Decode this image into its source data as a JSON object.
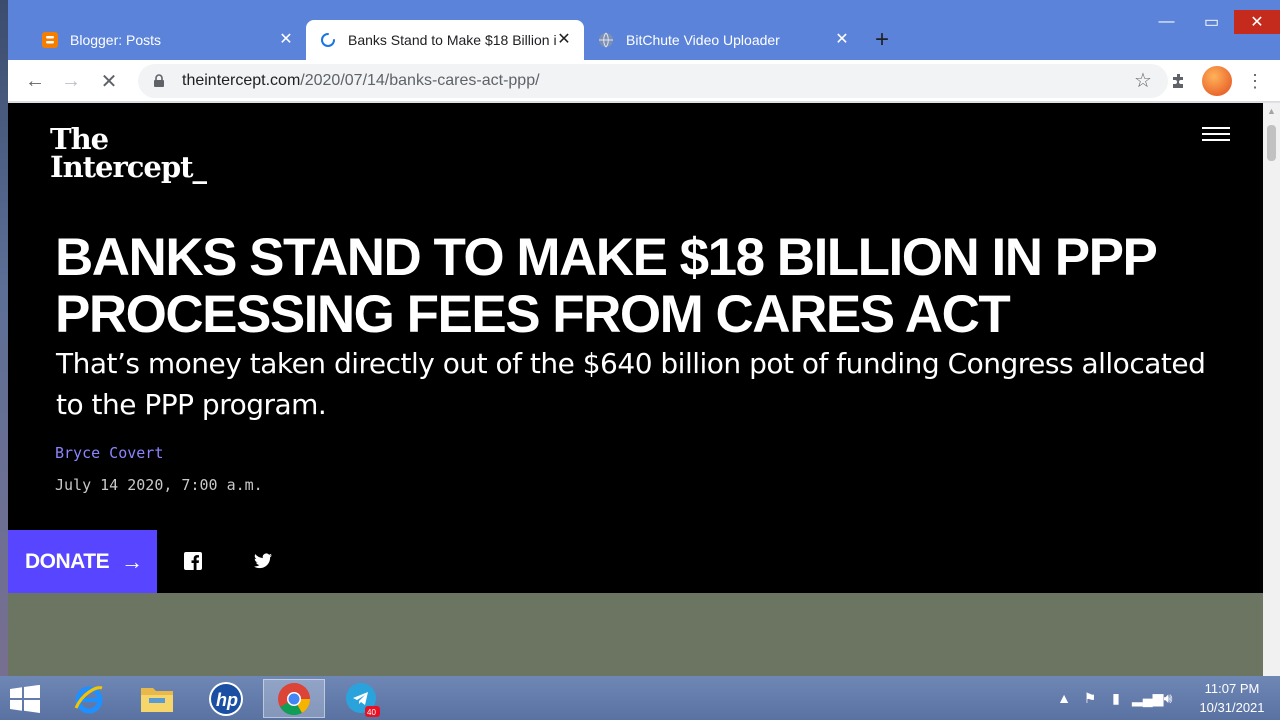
{
  "browser": {
    "tabs": [
      {
        "title": "Blogger: Posts",
        "favicon": "blogger-icon",
        "active": false
      },
      {
        "title": "Banks Stand to Make $18 Billion i",
        "favicon": "loading-spinner-icon",
        "active": true
      },
      {
        "title": "BitChute Video Uploader",
        "favicon": "globe-icon",
        "active": false
      }
    ],
    "new_tab_label": "+",
    "url_host": "theintercept.com",
    "url_path": "/2020/07/14/banks-cares-act-ppp/"
  },
  "page": {
    "logo_line1": "The",
    "logo_line2": "Intercept_",
    "headline": "BANKS STAND TO MAKE $18 BILLION IN PPP PROCESSING FEES FROM CARES ACT",
    "dek": "That’s money taken directly out of the $640 billion pot of funding Congress allocated to the PPP program.",
    "author": "Bryce Covert",
    "date": "July 14 2020, 7:00 a.m.",
    "donate_label": "DONATE",
    "donate_arrow": "→",
    "colors": {
      "accent": "#5745ff",
      "author": "#8c84ff",
      "band": "#6b7562"
    }
  },
  "taskbar": {
    "apps": [
      "internet-explorer-icon",
      "file-explorer-icon",
      "hp-icon",
      "chrome-icon",
      "telegram-icon"
    ],
    "telegram_badge": "40",
    "time": "11:07 PM",
    "date": "10/31/2021"
  }
}
